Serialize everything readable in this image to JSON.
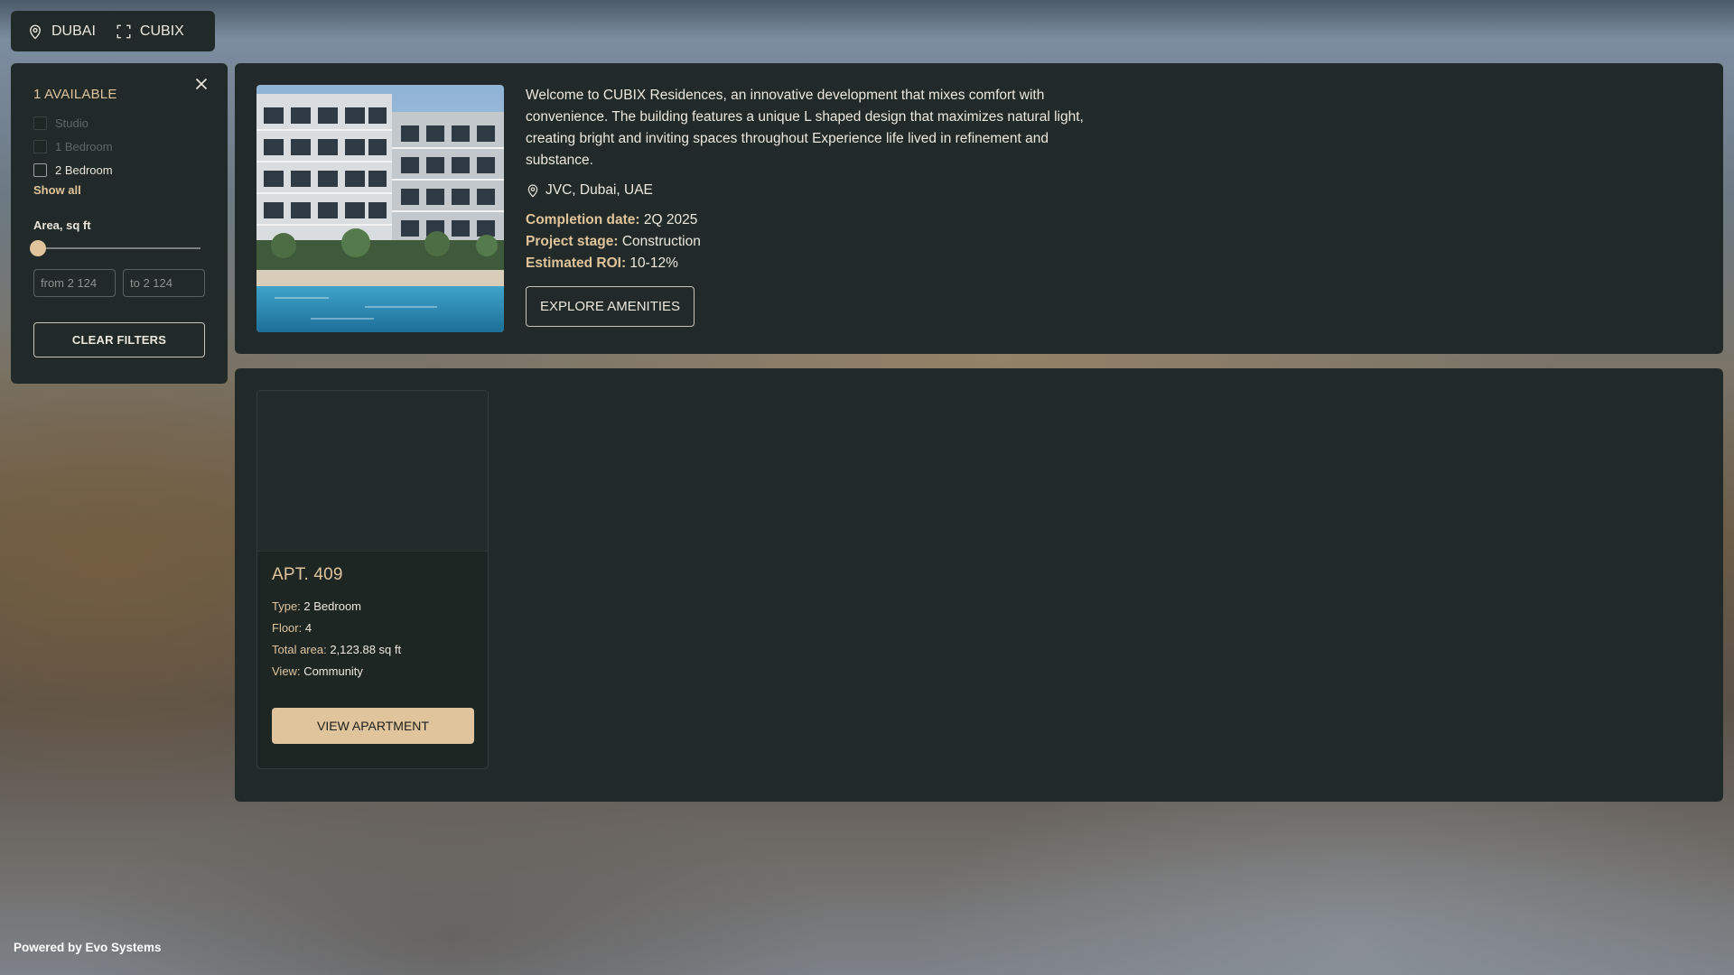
{
  "topbar": {
    "city_label": "DUBAI",
    "city_icon": "location-pin-icon",
    "project_label": "CUBIX",
    "project_icon": "expand-frame-icon"
  },
  "filters": {
    "available_count": "1 AVAILABLE",
    "close_icon": "close-icon",
    "options": [
      {
        "label": "Studio",
        "checked": false,
        "enabled": false
      },
      {
        "label": "1 Bedroom",
        "checked": false,
        "enabled": false
      },
      {
        "label": "2 Bedroom",
        "checked": false,
        "enabled": true
      }
    ],
    "show_all": "Show all",
    "area_label": "Area, sq ft",
    "slider_value_fraction": 0,
    "from_placeholder": "from 2 124",
    "to_placeholder": "to 2 124",
    "clear_label": "CLEAR FILTERS"
  },
  "project": {
    "description": "Welcome to CUBIX Residences, an innovative development that mixes comfort with convenience. The building features a unique L shaped design that maximizes natural light, creating bright and inviting spaces throughout Experience life lived in refinement and substance.",
    "location": "JVC, Dubai, UAE",
    "location_icon": "location-pin-icon",
    "meta": [
      {
        "key": "Completion date:",
        "value": "2Q 2025"
      },
      {
        "key": "Project stage:",
        "value": "Construction"
      },
      {
        "key": "Estimated ROI:",
        "value": "10-12%"
      }
    ],
    "amenities_label": "EXPLORE AMENITIES"
  },
  "apartments": [
    {
      "title": "APT. 409",
      "rows": [
        {
          "key": "Type:",
          "value": "2 Bedroom"
        },
        {
          "key": "Floor:",
          "value": "4"
        },
        {
          "key": "Total area:",
          "value": "2,123.88 sq ft"
        },
        {
          "key": "View:",
          "value": "Community"
        }
      ],
      "button_label": "VIEW APARTMENT"
    }
  ],
  "footer": {
    "text": "Powered by Evo Systems"
  },
  "colors": {
    "accent": "#e0c49b",
    "panel": "#212a28",
    "text": "#ece8e0"
  }
}
